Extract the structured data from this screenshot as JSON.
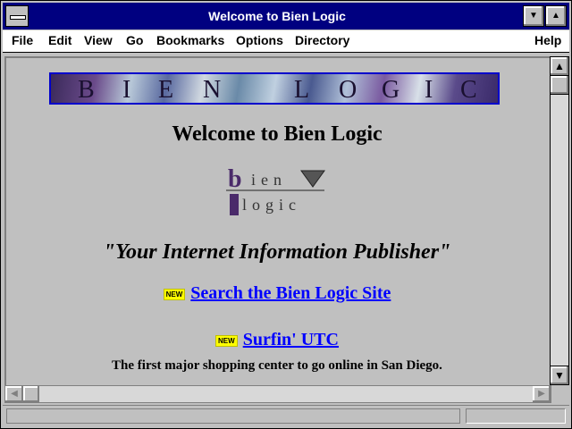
{
  "window": {
    "title": "Welcome to Bien Logic"
  },
  "menu": {
    "file": "File",
    "edit": "Edit",
    "view": "View",
    "go": "Go",
    "bookmarks": "Bookmarks",
    "options": "Options",
    "directory": "Directory",
    "help": "Help"
  },
  "page": {
    "banner_letters": [
      "B",
      "I",
      "E",
      "N",
      "L",
      "O",
      "G",
      "I",
      "C"
    ],
    "heading": "Welcome to Bien Logic",
    "logo_top": "bien",
    "logo_bottom": "logic",
    "tagline": "\"Your Internet Information Publisher\"",
    "links": [
      {
        "badge": "NEW",
        "text": "Search the Bien Logic Site"
      },
      {
        "badge": "NEW",
        "text": "Surfin' UTC"
      }
    ],
    "description": "The first major shopping center to go online in San Diego."
  },
  "colors": {
    "titlebar": "#000080",
    "link": "#0000ff",
    "badge": "#ffff00"
  },
  "icons": {
    "system_menu": "system-menu-icon",
    "minimize": "minimize-icon",
    "maximize": "maximize-icon"
  }
}
